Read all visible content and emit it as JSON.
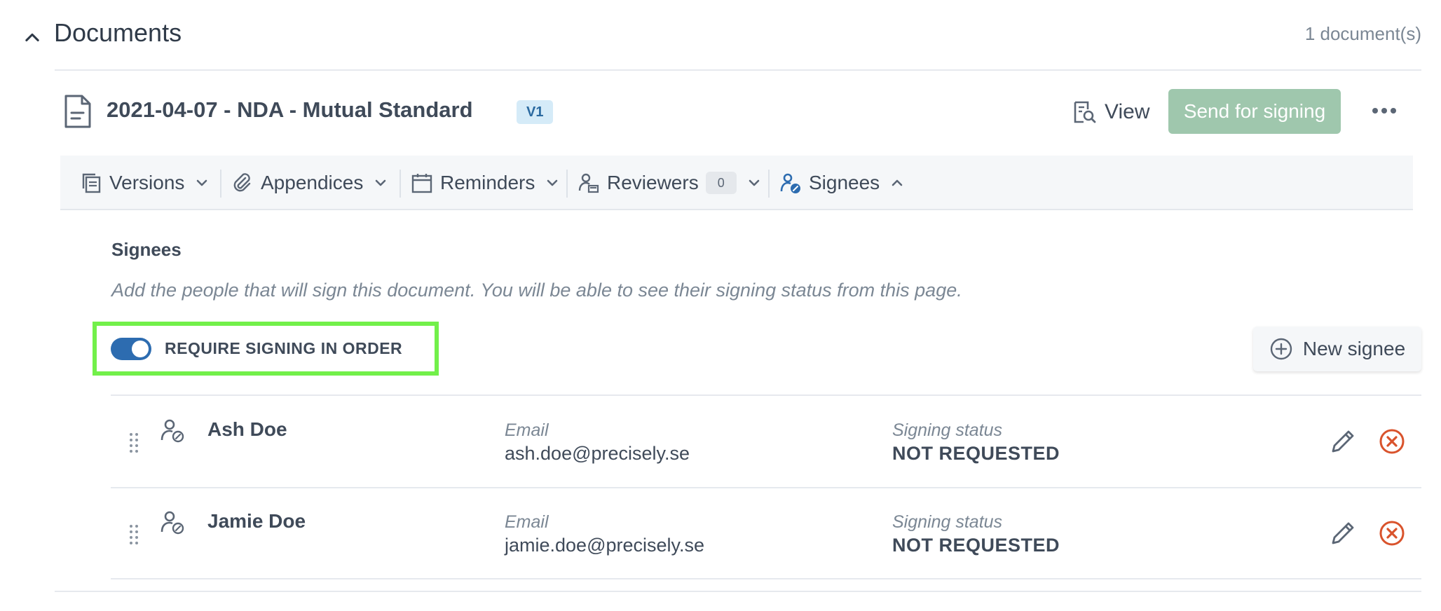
{
  "section": {
    "title": "Documents",
    "count": "1 document(s)"
  },
  "document": {
    "title": "2021-04-07 - NDA - Mutual Standard",
    "version": "V1",
    "view_label": "View",
    "send_label": "Send for signing"
  },
  "toolbar": {
    "versions": "Versions",
    "appendices": "Appendices",
    "reminders": "Reminders",
    "reviewers": "Reviewers",
    "reviewers_count": "0",
    "signees": "Signees"
  },
  "signees_panel": {
    "title": "Signees",
    "description": "Add the people that will sign this document. You will be able to see their signing status from this page.",
    "toggle_label": "REQUIRE SIGNING IN ORDER",
    "toggle_on": true,
    "new_signee_label": "New signee",
    "email_label": "Email",
    "status_label": "Signing status",
    "signees": [
      {
        "name": "Ash Doe",
        "email": "ash.doe@precisely.se",
        "status": "NOT REQUESTED"
      },
      {
        "name": "Jamie Doe",
        "email": "jamie.doe@precisely.se",
        "status": "NOT REQUESTED"
      }
    ]
  },
  "colors": {
    "accent": "#2d6cb0",
    "send_button": "#9fc7ad",
    "remove": "#d9532c",
    "highlight": "#72f04a"
  },
  "icons": {
    "collapse": "chevron-up-icon",
    "file": "file-icon",
    "view": "document-search-icon",
    "more": "more-horizontal-icon",
    "versions": "versions-icon",
    "appendices": "paperclip-icon",
    "reminders": "calendar-icon",
    "reviewers": "reviewer-icon",
    "signees": "signee-icon",
    "new_signee": "plus-circle-icon",
    "drag": "drag-handle-icon",
    "edit": "pencil-icon",
    "remove": "remove-circle-icon"
  }
}
